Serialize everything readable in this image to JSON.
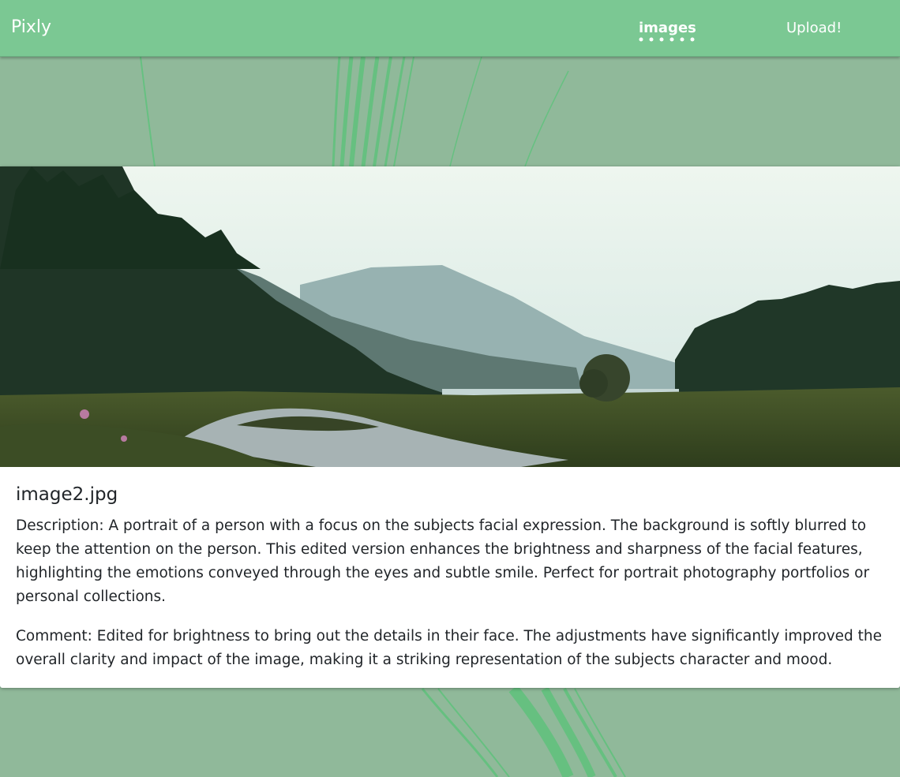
{
  "navbar": {
    "brand": "Pixly",
    "links": [
      {
        "label": "images"
      },
      {
        "label": "Upload!"
      }
    ]
  },
  "colors": {
    "navbar_bg": "#7bc893",
    "page_bg": "#90b99a",
    "card_bg": "#ffffff"
  },
  "card": {
    "title": "image2.jpg",
    "description": "Description: A portrait of a person with a focus on the subjects facial expression. The background is softly blurred to keep the attention on the person. This edited version enhances the brightness and sharpness of the facial features, highlighting the emotions conveyed through the eyes and subtle smile. Perfect for portrait photography portfolios or personal collections.",
    "comment": "Comment: Edited for brightness to bring out the details in their face. The adjustments have significantly improved the overall clarity and impact of the image, making it a striking representation of the subjects character and mood."
  }
}
